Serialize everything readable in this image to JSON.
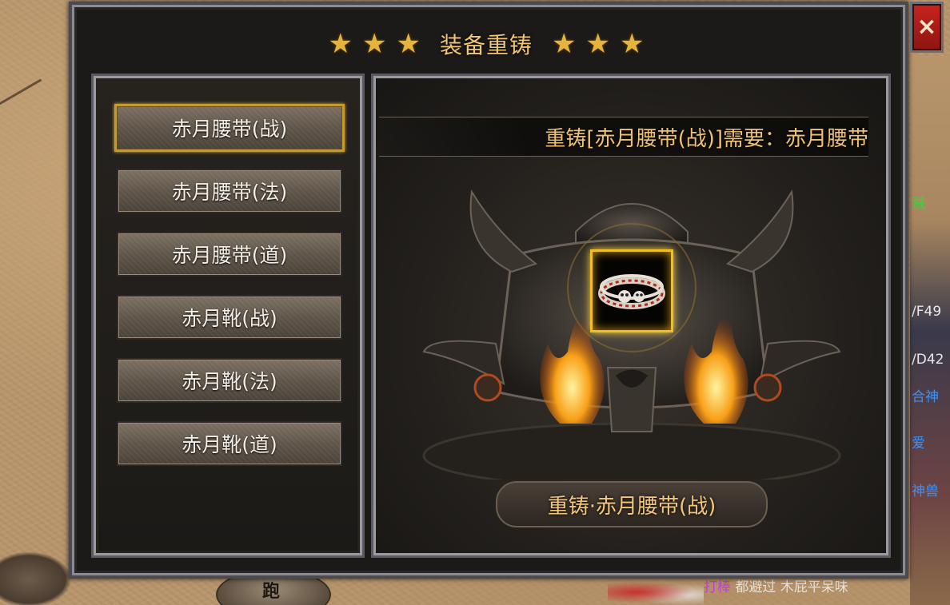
{
  "window": {
    "title": "装备重铸",
    "close_label": "×",
    "star": "★"
  },
  "equipment_list": [
    {
      "label": "赤月腰带(战)",
      "selected": true
    },
    {
      "label": "赤月腰带(法)",
      "selected": false
    },
    {
      "label": "赤月腰带(道)",
      "selected": false
    },
    {
      "label": "赤月靴(战)",
      "selected": false
    },
    {
      "label": "赤月靴(法)",
      "selected": false
    },
    {
      "label": "赤月靴(道)",
      "selected": false
    }
  ],
  "reforge": {
    "requirement_text": "重铸[赤月腰带(战)]需要：赤月腰带",
    "button_label": "重铸·赤月腰带(战)",
    "slot_item_icon": "ring-icon"
  },
  "scene": {
    "run_button_label": "跑",
    "side_texts": [
      "贼",
      "/F49",
      "/D42",
      "合神",
      "爱",
      "神兽"
    ],
    "bottom_chat_name": "打棒",
    "bottom_chat_text": "都避过 木屁平呆味"
  },
  "colors": {
    "title_gold": "#f0c675",
    "close_red": "#c8241e",
    "selected_border": "#c49a2e"
  }
}
